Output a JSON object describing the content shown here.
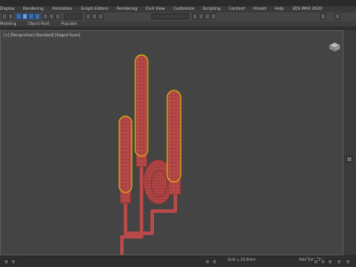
{
  "menu": [
    "Display",
    "Rendering",
    "Animation",
    "Graph Editors",
    "Rendering",
    "Civil View",
    "Customize",
    "Scripting",
    "Content",
    "Arnold",
    "Help"
  ],
  "workspace_label": "3DS MAX 2020",
  "ribbon_tabs": [
    "Modeling",
    "Object Paint",
    "Populate"
  ],
  "viewport_label": "[+] [Perspective] [Standard] [Edged Faces]",
  "status": {
    "grid": "Grid = 10.0mm",
    "add_time_tag": "Add Time Tag"
  },
  "colors": {
    "viewport_bg": "#444444",
    "wire_red": "#b84a4a",
    "selection_yellow": "#f2c200",
    "toolbar_blue": "#3b6fb6"
  },
  "icons": [
    "select-icon",
    "move-icon",
    "rotate-icon",
    "scale-icon",
    "snap-icon",
    "render-icon",
    "viewcube-icon",
    "maximize-icon"
  ]
}
